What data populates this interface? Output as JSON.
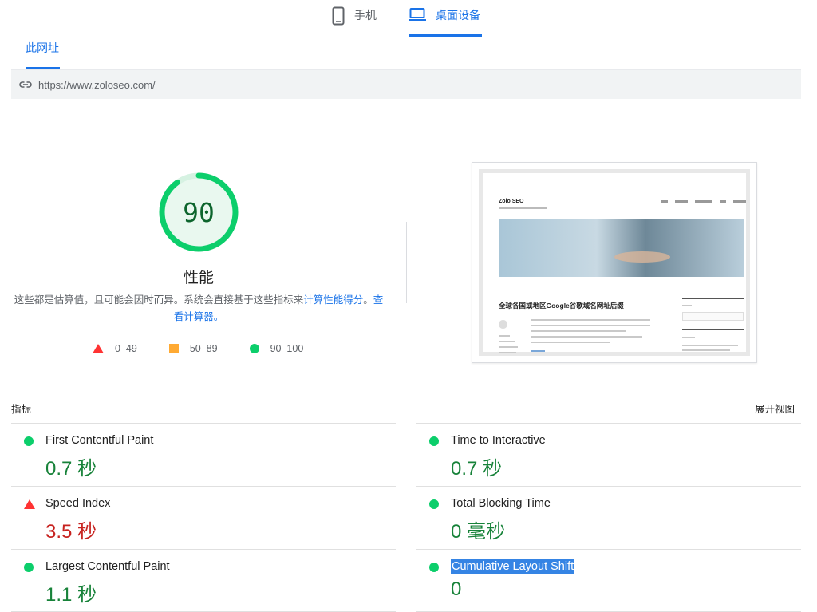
{
  "device_tabs": {
    "mobile_label": "手机",
    "desktop_label": "桌面设备",
    "active": "desktop"
  },
  "url_tab": {
    "label": "此网址"
  },
  "url_bar": {
    "url": "https://www.zoloseo.com/",
    "icon": "link-icon"
  },
  "score": {
    "value": "90",
    "fraction": 0.9,
    "label": "性能",
    "color": "#0cce6b"
  },
  "disclaimer": {
    "text": "这些都是估算值，且可能会因时而异。系统会直接基于这些指标来",
    "link1": "计算性能得分",
    "sep": "。",
    "link2": "查看计算器。"
  },
  "legend": [
    {
      "icon": "fail-triangle-icon",
      "label": "0–49",
      "color": "#ff3333"
    },
    {
      "icon": "average-square-icon",
      "label": "50–89",
      "color": "#ffaa33"
    },
    {
      "icon": "pass-circle-icon",
      "label": "90–100",
      "color": "#0cce6b"
    }
  ],
  "thumbnail": {
    "site_title": "Zolo SEO",
    "headline": "全球各国或地区Google谷歌域名网址后缀"
  },
  "metrics": {
    "title": "指标",
    "expand_label": "展开视图",
    "items": [
      {
        "name": "First Contentful Paint",
        "value": "0.7 秒",
        "status": "good"
      },
      {
        "name": "Time to Interactive",
        "value": "0.7 秒",
        "status": "good"
      },
      {
        "name": "Speed Index",
        "value": "3.5 秒",
        "status": "bad"
      },
      {
        "name": "Total Blocking Time",
        "value": "0 毫秒",
        "status": "good"
      },
      {
        "name": "Largest Contentful Paint",
        "value": "1.1 秒",
        "status": "good"
      },
      {
        "name": "Cumulative Layout Shift",
        "value": "0",
        "status": "good"
      }
    ]
  }
}
